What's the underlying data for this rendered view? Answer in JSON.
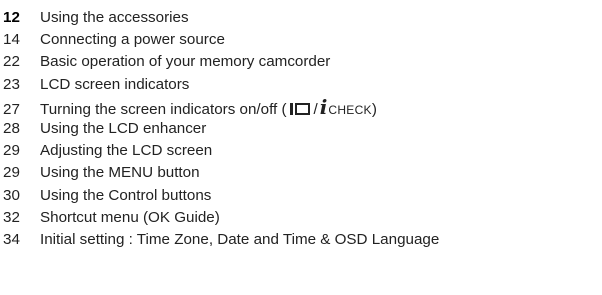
{
  "toc": {
    "entries": [
      {
        "page": "12",
        "title": "Using the accessories",
        "current": true
      },
      {
        "page": "14",
        "title": "Connecting a power source"
      },
      {
        "page": "22",
        "title": "Basic operation of your memory camcorder"
      },
      {
        "page": "23",
        "title": "LCD screen indicators"
      },
      {
        "page": "27",
        "title_prefix": "Turning the screen indicators on/off (",
        "slash": "/",
        "check_label": "CHECK",
        "title_suffix": ")",
        "icons": [
          "display-toggle-icon",
          "info-i-icon"
        ]
      },
      {
        "page": "28",
        "title": "Using the LCD enhancer"
      },
      {
        "page": "29",
        "title": "Adjusting the LCD screen"
      },
      {
        "page": "29",
        "title": "Using the MENU button"
      },
      {
        "page": "30",
        "title": "Using the Control buttons"
      },
      {
        "page": "32",
        "title": "Shortcut menu (OK Guide)"
      },
      {
        "page": "34",
        "title": "Initial setting : Time Zone, Date and Time & OSD Language"
      }
    ]
  },
  "colors": {
    "text": "#222222",
    "current_page": "#000000",
    "background": "#ffffff"
  }
}
